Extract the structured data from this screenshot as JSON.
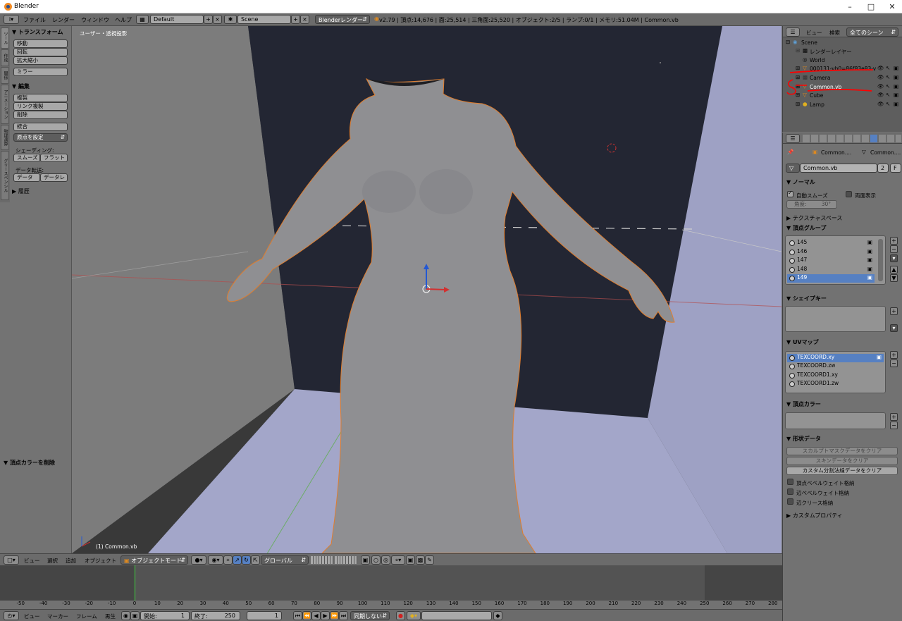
{
  "window": {
    "title": "Blender"
  },
  "menubar": {
    "items": [
      "ファイル",
      "レンダー",
      "ウィンドウ",
      "ヘルプ"
    ],
    "layout": "Default",
    "scene": "Scene",
    "engine": "Blenderレンダー",
    "stats": "v2.79 | 頂点:14,676 | 面:25,514 | 三角面:25,520 | オブジェクト:2/5 | ランプ:0/1 | メモリ:51.04M | Common.vb"
  },
  "toolshelf": {
    "tabs": [
      "ツール",
      "作成",
      "関係",
      "アニメーション",
      "物理演算",
      "グリースペンシル"
    ],
    "transform": {
      "header": "トランスフォーム",
      "buttons": [
        "移動",
        "回転",
        "拡大縮小",
        "ミラー"
      ]
    },
    "edit": {
      "header": "編集",
      "buttons": [
        "複製",
        "リンク複製",
        "削除",
        "統合"
      ],
      "origin": "原点を設定",
      "shading_label": "シェーディング:",
      "smooth": "スムーズ",
      "flat": "フラット",
      "transfer_label": "データ転送:",
      "data": "データ",
      "data_layout": "データレ"
    },
    "history": "履歴",
    "operator": "頂点カラーを削除"
  },
  "viewport": {
    "label": "ユーザー・透視投影",
    "object_label": "(1) Common.vb",
    "bg": "#393939",
    "floor": "#a3a6c9",
    "wall_left": "#7d7d7d",
    "wall_right": "#9ea1c4",
    "back": "#232633"
  },
  "outliner": {
    "view": "ビュー",
    "search": "検索",
    "filter": "全てのシーン",
    "rows": [
      "Scene",
      "レンダーレイヤー",
      "World",
      "000131-vb0=86f83e83-vs=",
      "Camera",
      "Common.vb",
      "Cube",
      "Lamp"
    ],
    "annotation_color": "#ff0000"
  },
  "properties": {
    "breadcrumb_object": "Common....",
    "breadcrumb_mesh": "Common....",
    "mesh_name": "Common.vb",
    "users": "2",
    "fake": "F",
    "normals": {
      "header": "ノーマル",
      "auto_smooth": "自動スムーズ",
      "double_sided": "両面表示",
      "angle": "角度:",
      "angle_value": "30°"
    },
    "texture_space": "テクスチャスペース",
    "vertex_groups": {
      "header": "頂点グループ",
      "items": [
        "145",
        "146",
        "147",
        "148",
        "149"
      ],
      "selected": "149"
    },
    "shape_keys": "シェイプキー",
    "uv_maps": {
      "header": "UVマップ",
      "items": [
        "TEXCOORD.xy",
        "TEXCOORD.zw",
        "TEXCOORD1.xy",
        "TEXCOORD1.zw"
      ],
      "selected": "TEXCOORD.xy"
    },
    "vertex_colors": "頂点カラー",
    "geometry": {
      "header": "形状データ",
      "clear_sculpt": "スカルプトマスクデータをクリア",
      "clear_skin": "スキンデータをクリア",
      "clear_custom": "カスタム分割法線データをクリア",
      "bevel_vertex": "頂点ベベルウェイト格納",
      "bevel_edge": "辺ベベルウェイト格納",
      "crease": "辺クリース格納"
    },
    "custom_props": "カスタムプロパティ"
  },
  "view3d_header": {
    "items": [
      "ビュー",
      "選択",
      "追加",
      "オブジェクト"
    ],
    "mode": "オブジェクトモード",
    "orientation": "グローバル"
  },
  "timeline": {
    "ticks": [
      -50,
      -40,
      -30,
      -20,
      -10,
      0,
      10,
      20,
      30,
      40,
      50,
      60,
      70,
      80,
      90,
      100,
      110,
      120,
      130,
      140,
      150,
      160,
      170,
      180,
      190,
      200,
      210,
      220,
      230,
      240,
      250,
      260,
      270,
      280
    ],
    "current_frame": 1,
    "header_items": [
      "ビュー",
      "マーカー",
      "フレーム",
      "再生"
    ],
    "start_label": "開始:",
    "start": "1",
    "end_label": "終了:",
    "end": "250",
    "frame": "1",
    "sync": "同期しない"
  }
}
